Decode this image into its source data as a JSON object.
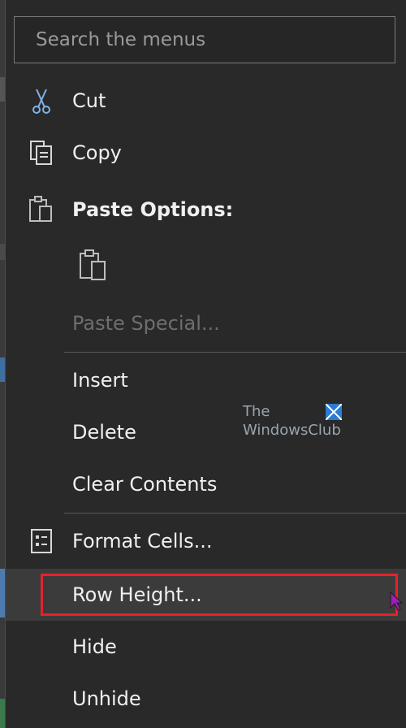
{
  "search": {
    "placeholder": "Search the menus"
  },
  "menu": {
    "cut": "Cut",
    "copy": "Copy",
    "paste_options": "Paste Options:",
    "paste_special": "Paste Special...",
    "insert": "Insert",
    "delete": "Delete",
    "clear_contents": "Clear Contents",
    "format_cells": "Format Cells...",
    "row_height": "Row Height...",
    "hide": "Hide",
    "unhide": "Unhide"
  },
  "watermark": {
    "line1": "The",
    "line2": "WindowsClub"
  },
  "colors": {
    "highlight": "#e8202a",
    "menu_bg": "#292929",
    "accent_logo": "#2b7cd3"
  }
}
